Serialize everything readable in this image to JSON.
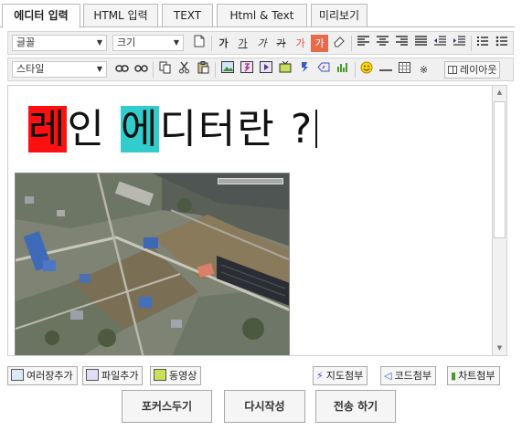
{
  "tabs": [
    {
      "label": "에디터 입력"
    },
    {
      "label": "HTML 입력"
    },
    {
      "label": "TEXT"
    },
    {
      "label": "Html & Text"
    },
    {
      "label": "미리보기"
    }
  ],
  "toolbar1": {
    "font_select": "글꼴",
    "size_select": "크기",
    "bold": "가",
    "italic": "가",
    "underline": "가",
    "strike": "가",
    "text_color": "가",
    "bg_color": "가"
  },
  "toolbar2": {
    "style_select": "스타일",
    "layout_button": "레이아웃",
    "special_char": "※"
  },
  "editor": {
    "text_part1": "레",
    "text_part2": "인 ",
    "text_part3": "에",
    "text_part4": "디터란 ?"
  },
  "attachments": {
    "photo": "여러장추가",
    "file": "파일추가",
    "video": "동영상",
    "map": "지도첨부",
    "code": "코드첨부",
    "chart": "차트첨부"
  },
  "actions": {
    "focus": "포커스두기",
    "rewrite": "다시작성",
    "submit": "전송 하기"
  },
  "colors": {
    "highlight_red": "#ff1010",
    "highlight_cyan": "#33cccc"
  }
}
